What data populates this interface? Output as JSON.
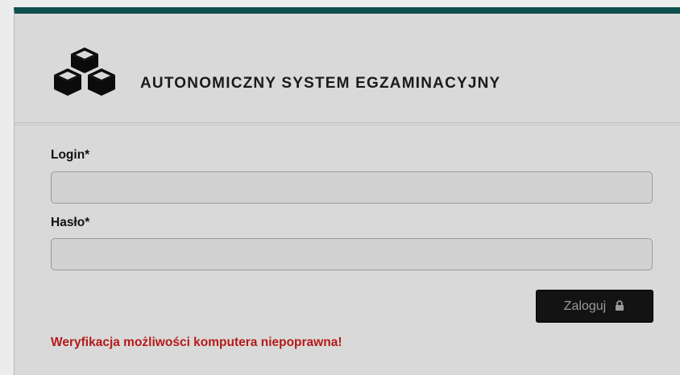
{
  "header": {
    "title": "AUTONOMICZNY SYSTEM EGZAMINACYJNY",
    "logo_icon": "cubes-icon"
  },
  "form": {
    "login_label": "Login*",
    "login_value": "",
    "password_label": "Hasło*",
    "password_value": "",
    "submit_label": "Zaloguj",
    "submit_icon": "lock-icon"
  },
  "status": {
    "error_message": "Weryfikacja możliwości komputera niepoprawna!"
  },
  "colors": {
    "accent_bar": "#0e4f4f",
    "error_text": "#b51a1a",
    "button_bg": "#131313"
  }
}
